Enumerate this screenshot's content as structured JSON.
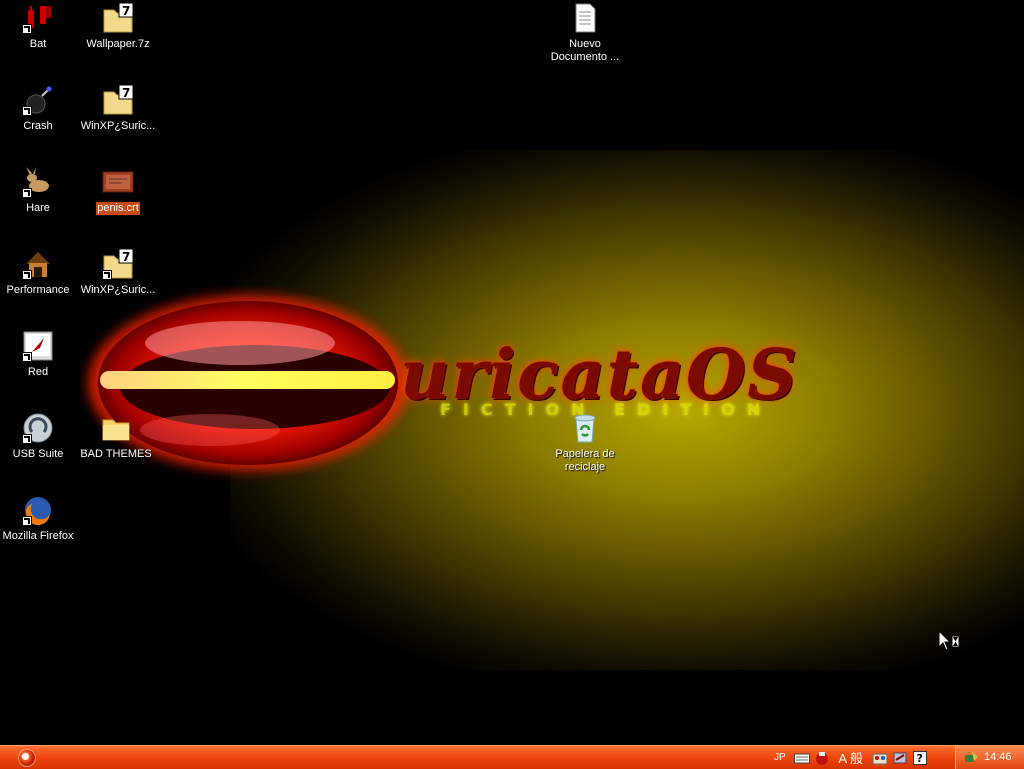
{
  "desktop": {
    "wallpaper": {
      "logo_text": "uricataOS",
      "logo_subtitle": "FICTION EDITION",
      "colors": {
        "glow": "#b8a800",
        "ring": "#ff2a00",
        "text": "#7a0a00"
      }
    },
    "icons": [
      {
        "label": "Bat",
        "icon": "bat-file-icon",
        "shortcut": true
      },
      {
        "label": "Wallpaper.7z",
        "icon": "7z-archive-icon",
        "shortcut": false
      },
      {
        "label": "Nuevo Documento ...",
        "icon": "text-document-icon",
        "shortcut": false
      },
      {
        "label": "Crash",
        "icon": "bomb-icon",
        "shortcut": true
      },
      {
        "label": "WinXP¿Suric...",
        "icon": "7z-archive-icon",
        "shortcut": false
      },
      {
        "label": "Hare",
        "icon": "hare-icon",
        "shortcut": true
      },
      {
        "label": "penis.crt",
        "icon": "certificate-icon",
        "shortcut": false,
        "selected": true
      },
      {
        "label": "Performance",
        "icon": "doghouse-icon",
        "shortcut": true
      },
      {
        "label": "WinXP¿Suric...",
        "icon": "7z-archive-icon",
        "shortcut": true
      },
      {
        "label": "Red",
        "icon": "window-rocket-icon",
        "shortcut": true
      },
      {
        "label": "USB Suite",
        "icon": "usb-suite-icon",
        "shortcut": true
      },
      {
        "label": "BAD THEMES",
        "icon": "folder-icon",
        "shortcut": false
      },
      {
        "label": "Papelera de reciclaje",
        "icon": "recycle-bin-icon",
        "shortcut": false
      },
      {
        "label": "Mozilla Firefox",
        "icon": "firefox-icon",
        "shortcut": true
      }
    ]
  },
  "taskbar": {
    "color": "#f04a10",
    "language": "JP",
    "ime_text": "A 般",
    "clock": "14:46",
    "tray_icons": [
      "keyboard-icon",
      "ime-icon",
      "ime-mode-icon",
      "ime-tools-icon",
      "ime-pad-icon",
      "help-icon",
      "network-icon"
    ]
  }
}
